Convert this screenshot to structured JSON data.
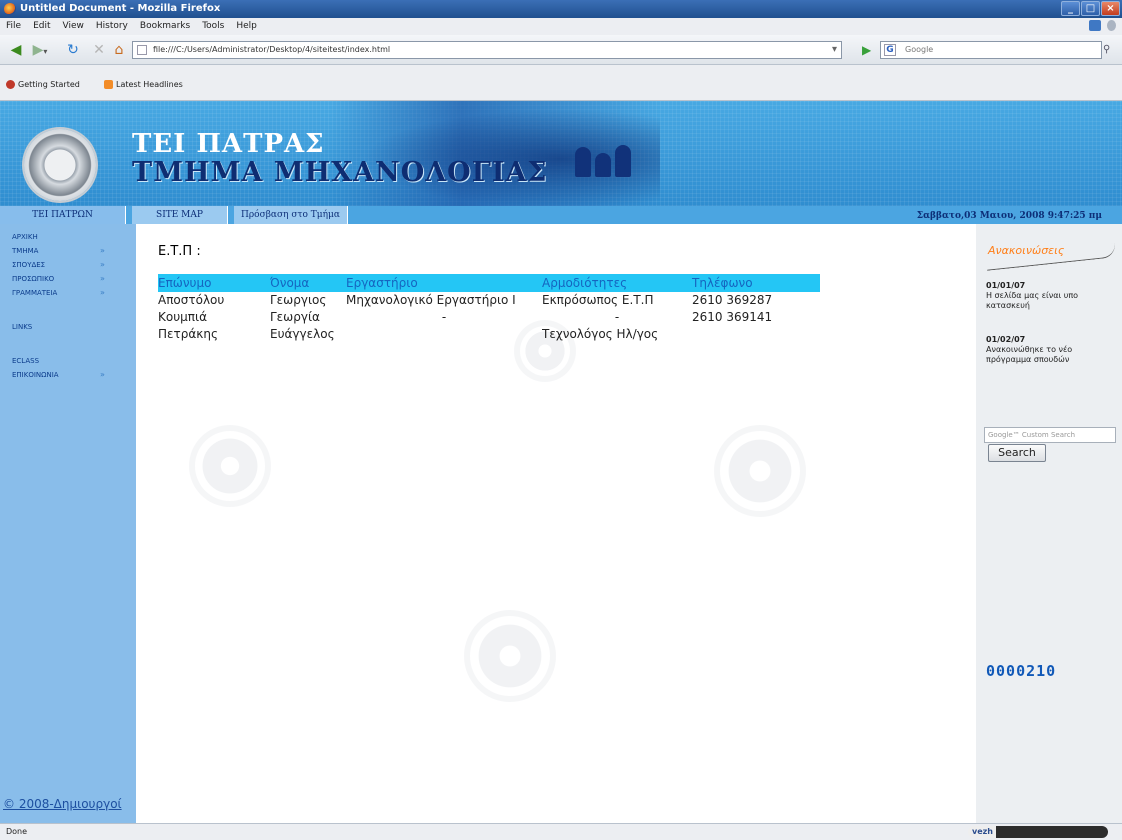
{
  "window": {
    "title": "Untitled Document - Mozilla Firefox"
  },
  "menu": [
    "File",
    "Edit",
    "View",
    "History",
    "Bookmarks",
    "Tools",
    "Help"
  ],
  "address": {
    "url": "file:///C:/Users/Administrator/Desktop/4/siteitest/index.html"
  },
  "search": {
    "placeholder": "Google",
    "provider": "G"
  },
  "bookmarks": [
    "Getting Started",
    "Latest Headlines"
  ],
  "banner": {
    "title_line1": "ΤΕΙ ΠΑΤΡΑΣ",
    "title_line2": "ΤΜΗΜΑ ΜΗΧΑΝΟΛΟΓΙΑΣ"
  },
  "topnav": {
    "tabs": [
      "ΤΕΙ ΠΑΤΡΩΝ",
      "SITE MAP",
      "Πρόσβαση στο Τμήμα"
    ],
    "datetime": "Σαββατο,03 Μαιου, 2008 9:47:25 πμ"
  },
  "sidebar": {
    "items": [
      {
        "label": "ΑΡΧΙΚΗ",
        "chev": ""
      },
      {
        "label": "ΤΜΗΜΑ",
        "chev": "»"
      },
      {
        "label": "ΣΠΟΥΔΕΣ",
        "chev": "»"
      },
      {
        "label": "ΠΡΟΣΩΠΙΚΟ",
        "chev": "»"
      },
      {
        "label": "ΓΡΑΜΜΑΤΕΙΑ",
        "chev": "»"
      },
      {
        "label": "LINKS",
        "chev": ""
      },
      {
        "label": "ECLASS",
        "chev": ""
      },
      {
        "label": "ΕΠΙΚΟΙΝΩΝΙΑ",
        "chev": "»"
      }
    ],
    "copyright": "© 2008-Δημιουργοί"
  },
  "content": {
    "title": "Ε.Τ.Π :",
    "table": {
      "headers": [
        "Επώνυμο",
        "Όνομα",
        "Εργαστήριο",
        "Αρμοδιότητες",
        "Τηλέφωνο"
      ],
      "rows": [
        [
          "Αποστόλου",
          "Γεωργιος",
          "Μηχανολογικό Εργαστήριο Ι",
          "Εκπρόσωπος Ε.Τ.Π",
          "2610 369287"
        ],
        [
          "Κουμπιά",
          "Γεωργία",
          "-",
          "-",
          "2610 369141"
        ],
        [
          "Πετράκης",
          "Ευάγγελος",
          "",
          "Τεχνολόγος Ηλ/γος",
          ""
        ]
      ]
    }
  },
  "right": {
    "announcements_title": "Ανακοινώσεις",
    "news": [
      {
        "date": "01/01/07",
        "text": "Η σελίδα μας είναι υπο κατασκευή"
      },
      {
        "date": "01/02/07",
        "text": "Ανακοινώθηκε το νέο πρόγραμμα σπουδών"
      }
    ],
    "search_placeholder": "Google™ Custom Search",
    "search_button": "Search",
    "counter": "0000210"
  },
  "status": {
    "text": "Done",
    "widget": "vezh"
  }
}
